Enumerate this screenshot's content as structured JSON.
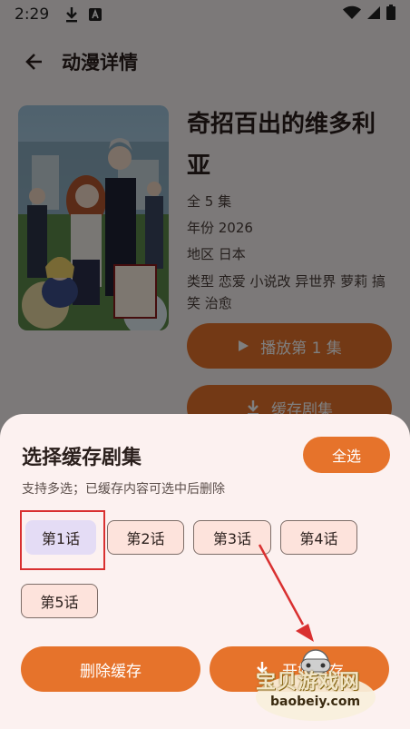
{
  "status_bar": {
    "time": "2:29"
  },
  "app_bar": {
    "title": "动漫详情"
  },
  "detail": {
    "title": "奇招百出的维多利亚",
    "episodes": "全 5 集",
    "year": "年份  2026",
    "region": "地区  日本",
    "tags": "类型  恋爱 小说改 异世界 萝莉 搞笑 治愈",
    "play_label": "播放第 1 集",
    "cache_label": "缓存剧集"
  },
  "sheet": {
    "title": "选择缓存剧集",
    "select_all": "全选",
    "subtitle": "支持多选；已缓存内容可选中后删除",
    "episodes": [
      "第1话",
      "第2话",
      "第3话",
      "第4话",
      "第5话"
    ],
    "selected_index": 0,
    "delete_label": "删除缓存",
    "start_label": "开始缓存"
  },
  "watermark": {
    "text": "宝贝游戏网",
    "url": "baobeiy.com"
  },
  "colors": {
    "accent": "#e6732b",
    "sheet_bg": "#fcf1f0",
    "chip_bg": "#fde3dc",
    "chip_selected": "#e4dcf5",
    "annotation": "#d93030"
  }
}
